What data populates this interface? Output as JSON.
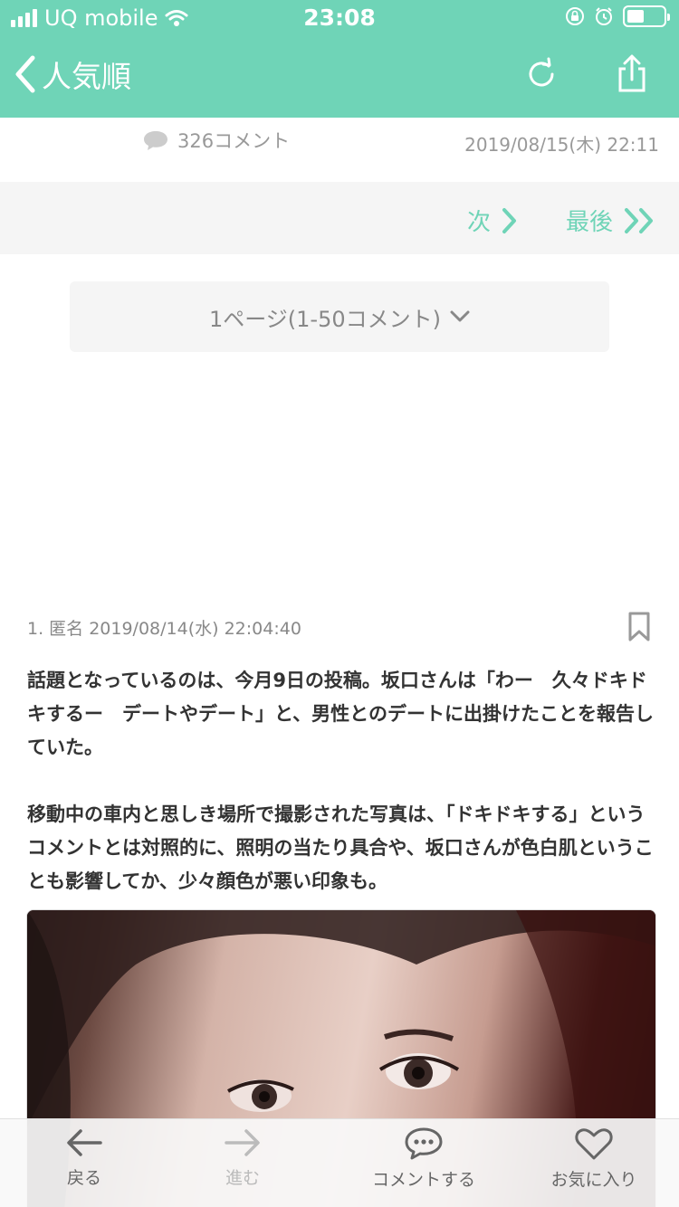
{
  "status_bar": {
    "carrier": "UQ mobile",
    "time": "23:08"
  },
  "nav": {
    "back_title": "人気順",
    "icons": [
      "chevron-left-icon",
      "refresh-icon",
      "share-icon"
    ]
  },
  "meta": {
    "comment_count": "326コメント",
    "posted_at": "2019/08/15(木) 22:11"
  },
  "pager": {
    "next_label": "次",
    "last_label": "最後"
  },
  "page_select": {
    "label": "1ページ(1-50コメント)"
  },
  "comment": {
    "header": "1. 匿名 2019/08/14(水) 22:04:40",
    "paragraphs": [
      "話題となっているのは、今月9日の投稿。坂口さんは「わー　久々ドキドキするー　デートやデート」と、男性とのデートに出掛けたことを報告していた。",
      "移動中の車内と思しき場所で撮影された写真は、「ドキドキする」というコメントとは対照的に、照明の当たり具合や、坂口さんが色白肌ということも影響してか、少々顔色が悪い印象も。"
    ]
  },
  "toolbar": {
    "back": "戻る",
    "forward": "進む",
    "comment": "コメントする",
    "favorite": "お気に入り"
  },
  "colors": {
    "accent": "#6fd4b7",
    "pager_bg": "#f5f5f5",
    "muted_text": "#999999"
  }
}
